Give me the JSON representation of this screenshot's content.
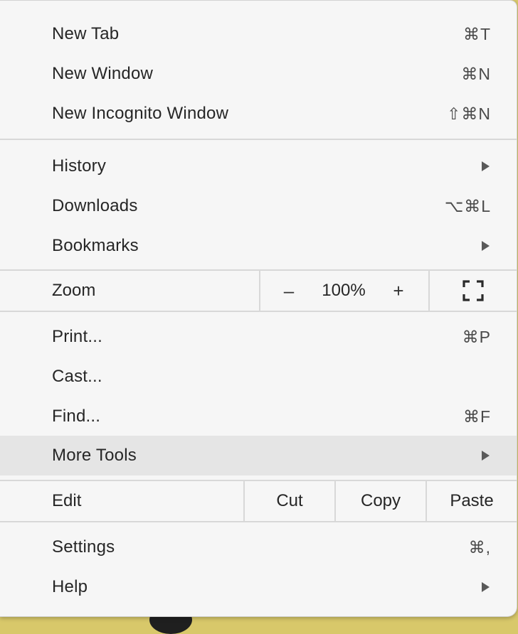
{
  "menu": {
    "items_group1": [
      {
        "label": "New Tab",
        "shortcut": "⌘T"
      },
      {
        "label": "New Window",
        "shortcut": "⌘N"
      },
      {
        "label": "New Incognito Window",
        "shortcut": "⇧⌘N"
      }
    ],
    "items_group2": [
      {
        "label": "History",
        "submenu": true
      },
      {
        "label": "Downloads",
        "shortcut": "⌥⌘L"
      },
      {
        "label": "Bookmarks",
        "submenu": true
      }
    ],
    "zoom": {
      "label": "Zoom",
      "minus": "–",
      "value": "100%",
      "plus": "+",
      "fullscreen_icon": "fullscreen-icon"
    },
    "items_group3": [
      {
        "label": "Print...",
        "shortcut": "⌘P"
      },
      {
        "label": "Cast..."
      },
      {
        "label": "Find...",
        "shortcut": "⌘F"
      },
      {
        "label": "More Tools",
        "submenu": true,
        "highlighted": true
      }
    ],
    "edit": {
      "label": "Edit",
      "cut": "Cut",
      "copy": "Copy",
      "paste": "Paste"
    },
    "items_group4": [
      {
        "label": "Settings",
        "shortcut": "⌘,"
      },
      {
        "label": "Help",
        "submenu": true
      }
    ]
  },
  "colors": {
    "menu_background": "#f6f6f6",
    "highlight": "#e5e5e5",
    "separator": "#d8d8d8",
    "backdrop": "#d8c86a"
  }
}
